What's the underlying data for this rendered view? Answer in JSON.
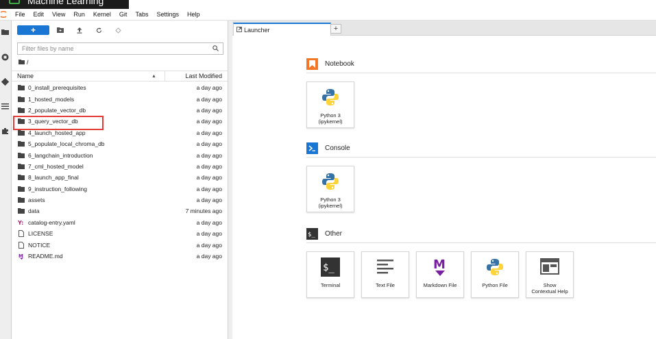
{
  "window": {
    "title": "Machine Learning",
    "accent": "#3fae49"
  },
  "menu": {
    "items": [
      "File",
      "Edit",
      "View",
      "Run",
      "Kernel",
      "Git",
      "Tabs",
      "Settings",
      "Help"
    ]
  },
  "activity_bar": {
    "icons": [
      "folder-icon",
      "running-icon",
      "git-icon",
      "toc-icon",
      "extension-icon"
    ]
  },
  "file_browser": {
    "new_label": "+",
    "search_placeholder": "Filter files by name",
    "breadcrumb": "/",
    "columns": {
      "name": "Name",
      "modified": "Last Modified"
    },
    "files": [
      {
        "name": "0_install_prerequisites",
        "modified": "a day ago",
        "type": "folder"
      },
      {
        "name": "1_hosted_models",
        "modified": "a day ago",
        "type": "folder"
      },
      {
        "name": "2_populate_vector_db",
        "modified": "a day ago",
        "type": "folder"
      },
      {
        "name": "3_query_vector_db",
        "modified": "a day ago",
        "type": "folder",
        "highlighted": true
      },
      {
        "name": "4_launch_hosted_app",
        "modified": "a day ago",
        "type": "folder"
      },
      {
        "name": "5_populate_local_chroma_db",
        "modified": "a day ago",
        "type": "folder"
      },
      {
        "name": "6_langchain_introduction",
        "modified": "a day ago",
        "type": "folder"
      },
      {
        "name": "7_cml_hosted_model",
        "modified": "a day ago",
        "type": "folder"
      },
      {
        "name": "8_launch_app_final",
        "modified": "a day ago",
        "type": "folder"
      },
      {
        "name": "9_instruction_following",
        "modified": "a day ago",
        "type": "folder"
      },
      {
        "name": "assets",
        "modified": "a day ago",
        "type": "folder"
      },
      {
        "name": "data",
        "modified": "7 minutes ago",
        "type": "folder"
      },
      {
        "name": "catalog-entry.yaml",
        "modified": "a day ago",
        "type": "yaml"
      },
      {
        "name": "LICENSE",
        "modified": "a day ago",
        "type": "file"
      },
      {
        "name": "NOTICE",
        "modified": "a day ago",
        "type": "file"
      },
      {
        "name": "README.md",
        "modified": "a day ago",
        "type": "markdown"
      }
    ]
  },
  "tabs": [
    {
      "label": "Launcher"
    }
  ],
  "launcher": {
    "notebook": {
      "title": "Notebook",
      "cards": [
        {
          "line1": "Python 3",
          "line2": "(ipykernel)"
        }
      ]
    },
    "console": {
      "title": "Console",
      "cards": [
        {
          "line1": "Python 3",
          "line2": "(ipykernel)"
        }
      ]
    },
    "other": {
      "title": "Other",
      "cards": [
        {
          "line1": "Terminal",
          "line2": ""
        },
        {
          "line1": "Text File",
          "line2": ""
        },
        {
          "line1": "Markdown File",
          "line2": ""
        },
        {
          "line1": "Python File",
          "line2": ""
        },
        {
          "line1": "Show",
          "line2": "Contextual Help"
        }
      ]
    }
  },
  "colors": {
    "brand_blue": "#1976d2",
    "notebook_orange": "#f37726",
    "highlight_red": "#e53935",
    "markdown_purple": "#7b1fa2"
  }
}
